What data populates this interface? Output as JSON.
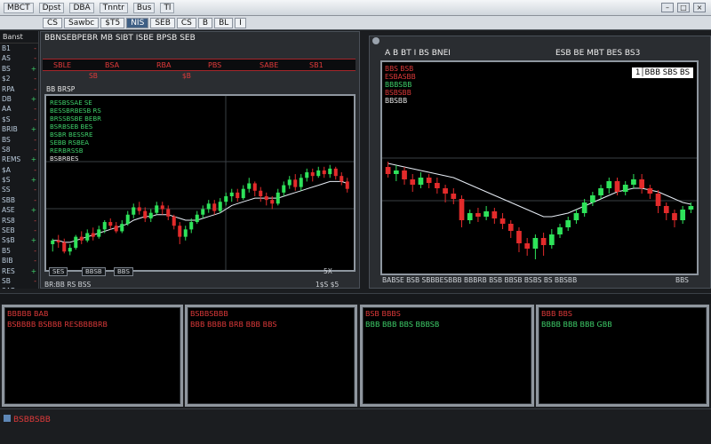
{
  "window": {
    "title": "",
    "menu": [
      "MBCT",
      "Dpst",
      "DBA",
      "Tnntr",
      "Bus",
      "Tl"
    ],
    "controls": [
      "–",
      "□",
      "×"
    ]
  },
  "toolbar": {
    "items": [
      "CS",
      "Sawbc",
      "$T5",
      "NIS",
      "SEB",
      "CS",
      "B",
      "BL",
      "I"
    ]
  },
  "watchlist": {
    "header": "Banst",
    "symbols": [
      "B1",
      "AS",
      "BS",
      "$2",
      "RPA",
      "DB",
      "AA",
      "$S",
      "BRIB",
      "BS",
      "S8",
      "REMS",
      "$A",
      "$S",
      "SS",
      "SBB",
      "ASE",
      "RS8",
      "SEB",
      "S$B",
      "B5",
      "BIB",
      "RES",
      "SB",
      "SAB"
    ],
    "changes": [
      "-",
      "-",
      "+",
      "-",
      "-",
      "+",
      "-",
      "-",
      "+",
      "-",
      "-",
      "+",
      "-",
      "+",
      "-",
      "-",
      "+",
      "-",
      "-",
      "+",
      "-",
      "-",
      "+",
      "-",
      "-"
    ]
  },
  "chart_left": {
    "heading": "BBNSEBPEBR MB SIBT ISBE BPSB SEB",
    "strip": [
      "SBLE",
      "BSA",
      "RBA",
      "PBS",
      "SABE",
      "SB1"
    ],
    "strip2": [
      "SB",
      "$B"
    ],
    "sub_heading": "BB BRSP",
    "indicators": [
      {
        "text": "RESBSSAE SE",
        "color": "green"
      },
      {
        "text": "BESSBRBESB RS",
        "color": "green"
      },
      {
        "text": "BRSSBSBE BEBR",
        "color": "green"
      },
      {
        "text": "BSRBSEB BES",
        "color": "green"
      },
      {
        "text": "BSBR BESSRE",
        "color": "green"
      },
      {
        "text": "SEBB RSBEA",
        "color": "green"
      },
      {
        "text": "RERBRSSB",
        "color": "green"
      },
      {
        "text": "BSBRBES",
        "color": "white"
      }
    ],
    "footer_left": "BR:BB RS BSS",
    "footer_buttons": [
      "SES",
      "BBSB",
      "BBS"
    ],
    "footer_right": "1$S  $5",
    "corner": "5X"
  },
  "chart_right": {
    "heading": "A B BT I BS BNEI",
    "heading_right": "ESB BE MBT BES BS3",
    "info_red": [
      "BBS BSB",
      "ESBASBB",
      "BSBSBB"
    ],
    "info_green": [
      "BBBSBB"
    ],
    "info_white": [
      "BBSBB"
    ],
    "box_text": "1│BBB SBS BS",
    "footer": "BABSE BSB SBBBESBBB BBBRB BSB BBSB BSBS BS BBSBB",
    "footer_right": "BBS"
  },
  "panels": [
    {
      "title": "BBBBB BAB",
      "line": "BSBBBB BSBBB  RESBBBBRB",
      "color": "red"
    },
    {
      "title": "BSBBSBBB",
      "line": "BBB  BBBB BRB BBB  BBS",
      "color": "red"
    },
    {
      "title": "BSB BBBS",
      "line": "BBB  BBB  BBS  BBBSB",
      "color": "green"
    },
    {
      "title": "BBB BBS",
      "line": "BBBB  BBB  BBB GBB",
      "color": "green"
    }
  ],
  "statusbar": {
    "text": "BSBBSBB"
  },
  "colors": {
    "up": "#2ee35a",
    "down": "#e32b2b",
    "frame": "#8e969f",
    "ma": "#e8eef6"
  },
  "chart_data": [
    {
      "type": "candlestick",
      "title": "",
      "candles": [
        [
          34,
          36,
          30,
          37
        ],
        [
          36,
          35,
          32,
          39
        ],
        [
          35,
          30,
          29,
          37
        ],
        [
          30,
          32,
          28,
          34
        ],
        [
          32,
          38,
          31,
          39
        ],
        [
          38,
          36,
          34,
          41
        ],
        [
          36,
          40,
          35,
          42
        ],
        [
          40,
          38,
          36,
          43
        ],
        [
          38,
          42,
          37,
          44
        ],
        [
          42,
          46,
          40,
          47
        ],
        [
          46,
          44,
          42,
          48
        ],
        [
          44,
          41,
          40,
          46
        ],
        [
          41,
          45,
          40,
          47
        ],
        [
          45,
          50,
          44,
          52
        ],
        [
          50,
          54,
          48,
          56
        ],
        [
          54,
          52,
          50,
          57
        ],
        [
          52,
          48,
          46,
          54
        ],
        [
          48,
          51,
          46,
          53
        ],
        [
          51,
          55,
          50,
          57
        ],
        [
          55,
          53,
          50,
          57
        ],
        [
          53,
          49,
          47,
          55
        ],
        [
          49,
          44,
          42,
          50
        ],
        [
          44,
          38,
          34,
          46
        ],
        [
          38,
          42,
          36,
          44
        ],
        [
          42,
          46,
          40,
          48
        ],
        [
          46,
          50,
          45,
          52
        ],
        [
          50,
          53,
          48,
          55
        ],
        [
          53,
          56,
          51,
          58
        ],
        [
          56,
          52,
          50,
          58
        ],
        [
          52,
          57,
          51,
          59
        ],
        [
          57,
          60,
          55,
          62
        ],
        [
          60,
          62,
          57,
          64
        ],
        [
          62,
          59,
          57,
          64
        ],
        [
          59,
          64,
          58,
          66
        ],
        [
          64,
          67,
          62,
          70
        ],
        [
          67,
          63,
          60,
          68
        ],
        [
          63,
          60,
          57,
          65
        ],
        [
          60,
          58,
          55,
          62
        ],
        [
          58,
          56,
          53,
          60
        ],
        [
          56,
          62,
          55,
          64
        ],
        [
          62,
          66,
          60,
          68
        ],
        [
          66,
          69,
          64,
          71
        ],
        [
          69,
          65,
          63,
          72
        ],
        [
          65,
          70,
          63,
          72
        ],
        [
          70,
          73,
          68,
          75
        ],
        [
          73,
          71,
          68,
          75
        ],
        [
          71,
          74,
          70,
          76
        ],
        [
          74,
          72,
          70,
          76
        ],
        [
          72,
          75,
          70,
          77
        ],
        [
          75,
          71,
          69,
          76
        ],
        [
          71,
          68,
          66,
          73
        ],
        [
          68,
          64,
          62,
          70
        ]
      ],
      "ma": [
        36,
        36,
        35,
        35,
        36,
        37,
        38,
        39,
        40,
        41,
        42,
        43,
        44,
        45,
        47,
        48,
        49,
        49,
        50,
        50,
        50,
        49,
        48,
        47,
        47,
        47,
        48,
        49,
        50,
        51,
        53,
        55,
        56,
        57,
        58,
        59,
        59,
        59,
        59,
        59,
        60,
        61,
        62,
        63,
        64,
        65,
        66,
        67,
        68,
        68,
        68,
        67
      ],
      "ylim": [
        20,
        100
      ]
    },
    {
      "type": "candlestick",
      "title": "",
      "candles": [
        [
          70,
          66,
          64,
          73
        ],
        [
          66,
          68,
          62,
          71
        ],
        [
          68,
          63,
          60,
          70
        ],
        [
          63,
          60,
          56,
          66
        ],
        [
          60,
          64,
          58,
          67
        ],
        [
          64,
          61,
          58,
          66
        ],
        [
          61,
          58,
          55,
          64
        ],
        [
          58,
          55,
          50,
          60
        ],
        [
          55,
          52,
          49,
          58
        ],
        [
          52,
          40,
          36,
          54
        ],
        [
          40,
          44,
          38,
          46
        ],
        [
          44,
          42,
          39,
          47
        ],
        [
          42,
          45,
          40,
          48
        ],
        [
          45,
          41,
          38,
          47
        ],
        [
          41,
          38,
          35,
          44
        ],
        [
          38,
          34,
          30,
          40
        ],
        [
          34,
          27,
          22,
          36
        ],
        [
          27,
          24,
          20,
          30
        ],
        [
          24,
          30,
          18,
          32
        ],
        [
          30,
          26,
          20,
          33
        ],
        [
          26,
          32,
          24,
          35
        ],
        [
          32,
          36,
          30,
          38
        ],
        [
          36,
          40,
          34,
          42
        ],
        [
          40,
          44,
          38,
          46
        ],
        [
          44,
          50,
          42,
          52
        ],
        [
          50,
          54,
          48,
          56
        ],
        [
          54,
          58,
          52,
          60
        ],
        [
          58,
          62,
          55,
          64
        ],
        [
          62,
          56,
          54,
          64
        ],
        [
          56,
          60,
          54,
          62
        ],
        [
          60,
          63,
          58,
          66
        ],
        [
          63,
          58,
          55,
          66
        ],
        [
          58,
          55,
          52,
          60
        ],
        [
          55,
          48,
          44,
          57
        ],
        [
          48,
          44,
          40,
          50
        ],
        [
          44,
          40,
          36,
          46
        ],
        [
          40,
          46,
          38,
          48
        ],
        [
          46,
          48,
          44,
          50
        ]
      ],
      "ma": [
        72,
        71,
        70,
        69,
        68,
        67,
        66,
        65,
        64,
        62,
        60,
        58,
        56,
        54,
        52,
        50,
        48,
        46,
        44,
        42,
        42,
        43,
        44,
        46,
        48,
        50,
        52,
        54,
        56,
        57,
        58,
        58,
        57,
        56,
        54,
        52,
        50,
        49
      ],
      "ylim": [
        10,
        100
      ]
    }
  ]
}
